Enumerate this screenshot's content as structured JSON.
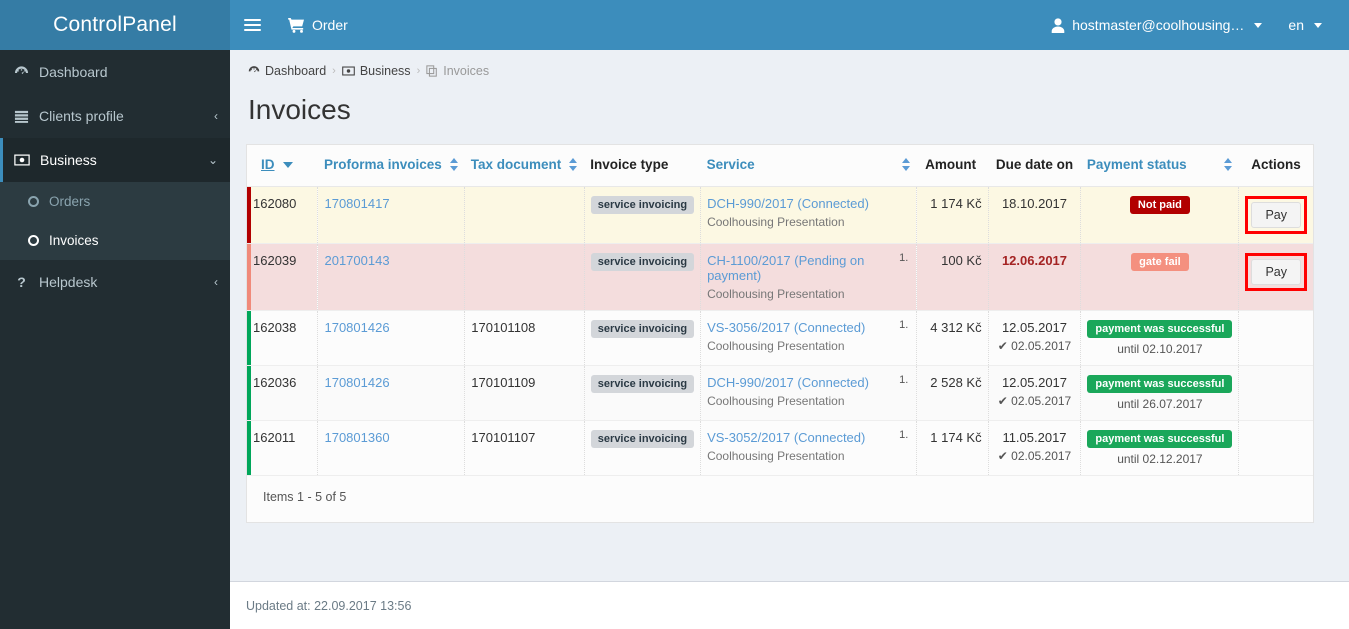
{
  "brand": {
    "name": "ControlPanel"
  },
  "topbar": {
    "menu_toggle": "menu-toggle",
    "order_label": "Order",
    "user_label": "hostmaster@coolhousing…",
    "lang_label": "en"
  },
  "sidebar": {
    "items": [
      {
        "label": "Dashboard",
        "icon": "dashboard-icon",
        "chevron": ""
      },
      {
        "label": "Clients profile",
        "icon": "clients-icon",
        "chevron": "‹"
      },
      {
        "label": "Business",
        "icon": "business-icon",
        "chevron": "⌄",
        "active": true
      },
      {
        "label": "Helpdesk",
        "icon": "helpdesk-icon",
        "chevron": "‹"
      }
    ],
    "submenu": [
      {
        "label": "Orders",
        "current": false
      },
      {
        "label": "Invoices",
        "current": true
      }
    ]
  },
  "breadcrumb": [
    {
      "label": "Dashboard",
      "icon": "dashboard-icon"
    },
    {
      "label": "Business",
      "icon": "business-icon"
    },
    {
      "label": "Invoices",
      "icon": "invoices-icon"
    }
  ],
  "breadcrumb_separator": "›",
  "page": {
    "title": "Invoices"
  },
  "table": {
    "columns": [
      {
        "key": "id",
        "label": "ID",
        "sortable": true,
        "sort": "desc",
        "style": "link"
      },
      {
        "key": "proforma",
        "label": "Proforma invoices",
        "sortable": true,
        "style": "link"
      },
      {
        "key": "tax",
        "label": "Tax document",
        "sortable": true,
        "style": "link"
      },
      {
        "key": "type",
        "label": "Invoice type",
        "sortable": false,
        "style": "dark"
      },
      {
        "key": "service",
        "label": "Service",
        "sortable": true,
        "style": "link"
      },
      {
        "key": "amount",
        "label": "Amount",
        "sortable": false,
        "style": "dark"
      },
      {
        "key": "due",
        "label": "Due date on",
        "sortable": false,
        "style": "dark"
      },
      {
        "key": "status",
        "label": "Payment status",
        "sortable": true,
        "style": "link"
      },
      {
        "key": "actions",
        "label": "Actions",
        "sortable": false,
        "style": "dark"
      }
    ],
    "rows": [
      {
        "state": "warn",
        "id": "162080",
        "proforma": "170801417",
        "tax": "",
        "type": "service invoicing",
        "service_name": "DCH-990/2017",
        "service_state": "(Connected)",
        "service_sub": "Coolhousing Presentation",
        "service_num": "",
        "amount": "1 174 Kč",
        "due": "18.10.2017",
        "due_overdue": false,
        "paid_on": "",
        "status_label": "Not paid",
        "status_kind": "red",
        "status_until": "",
        "action_label": "Pay",
        "action_highlighted": true
      },
      {
        "state": "danger",
        "id": "162039",
        "proforma": "201700143",
        "tax": "",
        "type": "service invoicing",
        "service_name": "CH-1100/2017",
        "service_state": "(Pending on payment)",
        "service_sub": "Coolhousing Presentation",
        "service_num": "1.",
        "amount": "100 Kč",
        "due": "12.06.2017",
        "due_overdue": true,
        "paid_on": "",
        "status_label": "gate fail",
        "status_kind": "salmon",
        "status_until": "",
        "action_label": "Pay",
        "action_highlighted": true
      },
      {
        "state": "ok",
        "id": "162038",
        "proforma": "170801426",
        "tax": "170101108",
        "type": "service invoicing",
        "service_name": "VS-3056/2017",
        "service_state": "(Connected)",
        "service_sub": "Coolhousing Presentation",
        "service_num": "1.",
        "amount": "4 312 Kč",
        "due": "12.05.2017",
        "due_overdue": false,
        "paid_on": "✔ 02.05.2017",
        "status_label": "payment was successful",
        "status_kind": "green",
        "status_until": "until 02.10.2017",
        "action_label": "",
        "action_highlighted": false
      },
      {
        "state": "ok2",
        "id": "162036",
        "proforma": "170801426",
        "tax": "170101109",
        "type": "service invoicing",
        "service_name": "DCH-990/2017",
        "service_state": "(Connected)",
        "service_sub": "Coolhousing Presentation",
        "service_num": "1.",
        "amount": "2 528 Kč",
        "due": "12.05.2017",
        "due_overdue": false,
        "paid_on": "✔ 02.05.2017",
        "status_label": "payment was successful",
        "status_kind": "green",
        "status_until": "until 26.07.2017",
        "action_label": "",
        "action_highlighted": false
      },
      {
        "state": "ok",
        "id": "162011",
        "proforma": "170801360",
        "tax": "170101107",
        "type": "service invoicing",
        "service_name": "VS-3052/2017",
        "service_state": "(Connected)",
        "service_sub": "Coolhousing Presentation",
        "service_num": "1.",
        "amount": "1 174 Kč",
        "due": "11.05.2017",
        "due_overdue": false,
        "paid_on": "✔ 02.05.2017",
        "status_label": "payment was successful",
        "status_kind": "green",
        "status_until": "until 02.12.2017",
        "action_label": "",
        "action_highlighted": false
      }
    ],
    "footer_count": "Items 1 - 5 of 5"
  },
  "footer": {
    "updated": "Updated at: 22.09.2017 13:56"
  },
  "colors": {
    "brand_dark": "#357ca5",
    "brand": "#3c8dbc",
    "sidebar": "#222d32",
    "submenu": "#2c3b41",
    "page_bg": "#ecf0f5",
    "link": "#3c8dbc",
    "row_warn": "#fcf8e3",
    "row_danger": "#f4dddd",
    "edge_red": "#b20000",
    "edge_salmon": "#f08a7a",
    "edge_green": "#00a65a",
    "badge_red": "#b20000",
    "badge_salmon": "#f4907f",
    "badge_green": "#1aa75a",
    "highlight": "#ff0000"
  }
}
